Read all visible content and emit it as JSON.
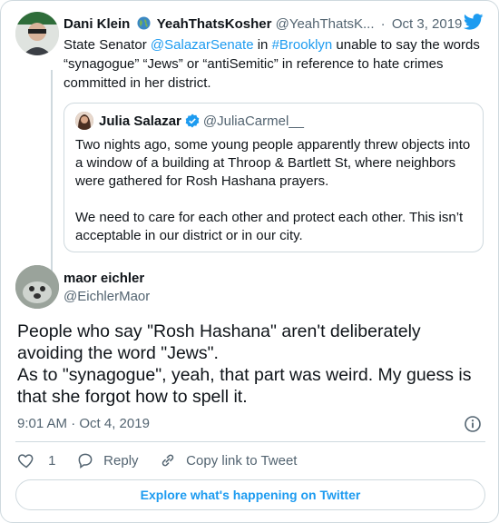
{
  "parent_tweet": {
    "author_name": "Dani Klein",
    "author_display_extra": "YeahThatsKosher",
    "handle": "@YeahThatsK...",
    "date": "Oct 3, 2019",
    "text_parts": [
      {
        "t": "State Senator ",
        "link": false
      },
      {
        "t": "@SalazarSenate",
        "link": true
      },
      {
        "t": " in ",
        "link": false
      },
      {
        "t": "#Brooklyn",
        "link": true
      },
      {
        "t": " unable to say the words “synagogue” “Jews” or “antiSemitic” in reference to hate crimes committed in her district.",
        "link": false
      }
    ],
    "quoted": {
      "author_name": "Julia Salazar",
      "handle": "@JuliaCarmel__",
      "paragraphs": [
        "Two nights ago, some young people apparently threw objects into a window of a building at Throop & Bartlett St, where neighbors were gathered for Rosh Hashana prayers.",
        "We need to care for each other and protect each other. This isn’t acceptable in our district or in our city."
      ]
    }
  },
  "main_tweet": {
    "author_name": "maor eichler",
    "handle": "@EichlerMaor",
    "lines": [
      "People who say \"Rosh Hashana\"  aren't deliberately avoiding the word \"Jews\".",
      "As to \"synagogue\", yeah, that part was weird. My guess is that  she forgot how to spell it."
    ],
    "timestamp": "9:01 AM · Oct 4, 2019",
    "like_count": "1",
    "reply_label": "Reply",
    "copy_link_label": "Copy link to Tweet"
  },
  "footer": {
    "explore_label": "Explore what's happening on Twitter"
  },
  "colors": {
    "accent": "#1d9bf0",
    "muted_text": "#536471",
    "border": "#cfd9de"
  },
  "icons": [
    "twitter-bird-icon",
    "globe-icon",
    "verified-badge-icon",
    "info-icon",
    "heart-icon",
    "reply-icon",
    "link-icon"
  ]
}
